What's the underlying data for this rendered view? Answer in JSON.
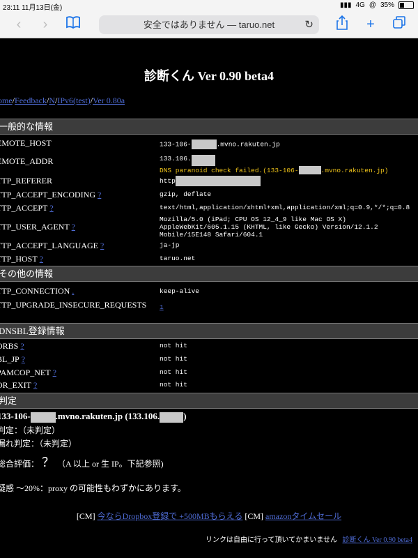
{
  "status": {
    "time": "23:11",
    "date": "11月13日(金)",
    "network": "4G",
    "battery": "35%"
  },
  "browser": {
    "url_text": "安全ではありません — taruo.net"
  },
  "page": {
    "title": "診断くん Ver 0.90 beta4",
    "nav": [
      "ome",
      "Feedback",
      "N",
      "IPv6(test)",
      "Ver 0.80a"
    ],
    "sections": {
      "general": "一般的な情報",
      "other": "その他の情報",
      "dnsbl": "DNSBL登録情報",
      "judge": "判定"
    },
    "general_rows": [
      {
        "key": "EMOTE_HOST",
        "q": "",
        "value_pre": "133-106-",
        "value_post": ".mvno.rakuten.jp"
      },
      {
        "key": "EMOTE_ADDR",
        "q": "",
        "value_pre": "133.106.",
        "value_post": "",
        "warn_pre": "DNS paranoid check failed.(133-106-",
        "warn_post": ".mvno.rakuten.jp)"
      },
      {
        "key": "TTP_REFERER",
        "q": "",
        "value_pre": "http",
        "value_post": ""
      },
      {
        "key": "TTP_ACCEPT_ENCODING",
        "q": "?",
        "value": "gzip, deflate"
      },
      {
        "key": "TTP_ACCEPT",
        "q": "?",
        "value": "text/html,application/xhtml+xml,application/xml;q=0.9,*/*;q=0.8"
      },
      {
        "key": "TTP_USER_AGENT",
        "q": "?",
        "value": "Mozilla/5.0 (iPad; CPU OS 12_4_9 like Mac OS X)\nAppleWebKit/605.1.15 (KHTML, like Gecko) Version/12.1.2\nMobile/15E148 Safari/604.1"
      },
      {
        "key": "TTP_ACCEPT_LANGUAGE",
        "q": "?",
        "value": "ja-jp"
      },
      {
        "key": "TTP_HOST",
        "q": "?",
        "value": "taruo.net"
      }
    ],
    "other_rows": [
      {
        "key": "TTP_CONNECTION",
        "q": ".",
        "value": "keep-alive"
      },
      {
        "key": "TTP_UPGRADE_INSECURE_REQUESTS",
        "q": "",
        "value": "1"
      }
    ],
    "dnsbl_rows": [
      {
        "key": "ORBS",
        "q": "?",
        "value": "not hit"
      },
      {
        "key": "BL_JP",
        "q": "?",
        "value": "not hit"
      },
      {
        "key": "PAMCOP_NET",
        "q": "?",
        "value": "not hit"
      },
      {
        "key": "OR_EXIT",
        "q": "?",
        "value": "not hit"
      }
    ],
    "judge": {
      "host_pre": "133-106-",
      "host_mid": ".mvno.rakuten.jp (133.106.",
      "host_post": ")",
      "line1": "判定：（未判定）",
      "line2": "漏れ判定：（未判定）",
      "line3_pre": "総合評価：",
      "line3_q": "？",
      "line3_post": "（A 以上 or 生 IP。下記参照)",
      "line4": "疑惑 〜20%：proxy の可能性もわずかにあります。"
    },
    "ads": {
      "cm1": "[CM]",
      "link1": "今ならDropbox登録で +500MBもらえる",
      "cm2": "[CM]",
      "link2": "amazonタイムセール"
    },
    "footer": {
      "text": "リンクは自由に行って頂いてかまいません",
      "link": "診断くん Ver 0.90 beta4"
    }
  }
}
